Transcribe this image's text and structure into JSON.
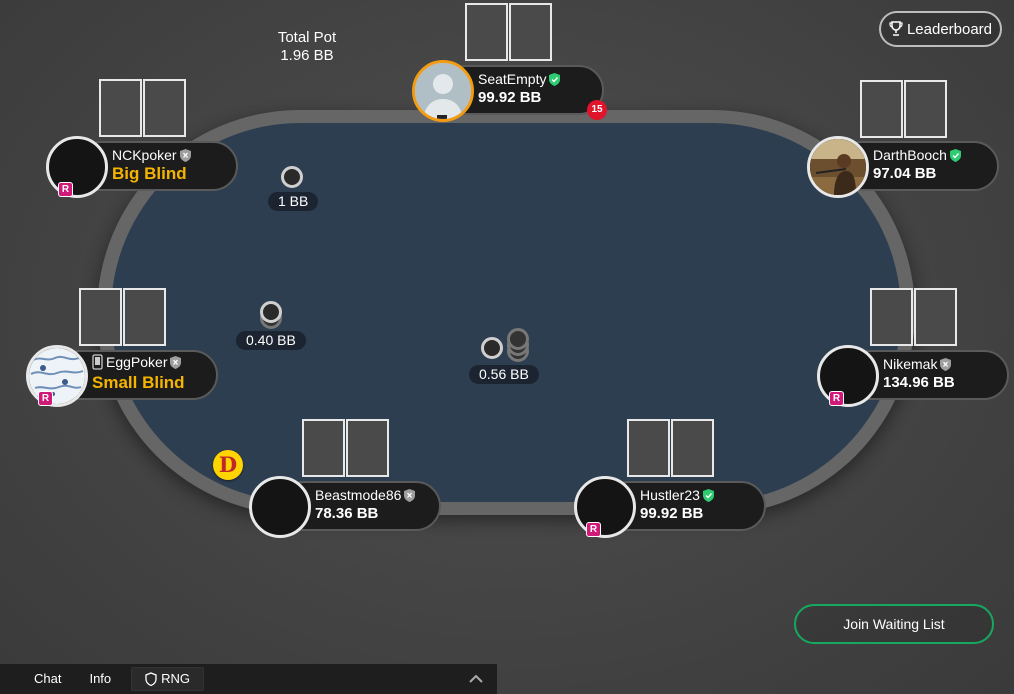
{
  "header": {
    "total_pot_label": "Total Pot",
    "total_pot_value": "1.96 BB",
    "leaderboard_label": "Leaderboard"
  },
  "seats": [
    {
      "name": "SeatEmpty",
      "stack": "99.92 BB",
      "verified": "green-shield",
      "timer": "15"
    },
    {
      "name": "DarthBooch",
      "stack": "97.04 BB",
      "verified": "green-shield"
    },
    {
      "name": "Nikemak",
      "stack": "134.96 BB",
      "verified": "gray-shield",
      "badge": "R"
    },
    {
      "name": "Hustler23",
      "stack": "99.92 BB",
      "verified": "green-shield",
      "badge": "R"
    },
    {
      "name": "Beastmode86",
      "stack": "78.36 BB",
      "verified": "gray-shield"
    },
    {
      "name": "EggPoker",
      "stack": "Small Blind",
      "verified": "gray-shield",
      "badge": "R",
      "device": "mobile-icon"
    },
    {
      "name": "NCKpoker",
      "stack": "Big Blind",
      "verified": "gray-shield",
      "badge": "R"
    }
  ],
  "bets": {
    "big_blind_bet": "1 BB",
    "small_blind_bet": "0.40 BB",
    "pot": "0.56 BB"
  },
  "dealer_button": "D",
  "join_waiting_list": "Join Waiting List",
  "bottom_bar": {
    "chat": "Chat",
    "info": "Info",
    "rng": "RNG"
  },
  "colors": {
    "felt": "#2c3e50",
    "rail": "#666666",
    "blind_text": "#f5b400",
    "verified_green": "#2ecc71",
    "join_border": "#17a85f",
    "r_badge": "#d1197a"
  }
}
